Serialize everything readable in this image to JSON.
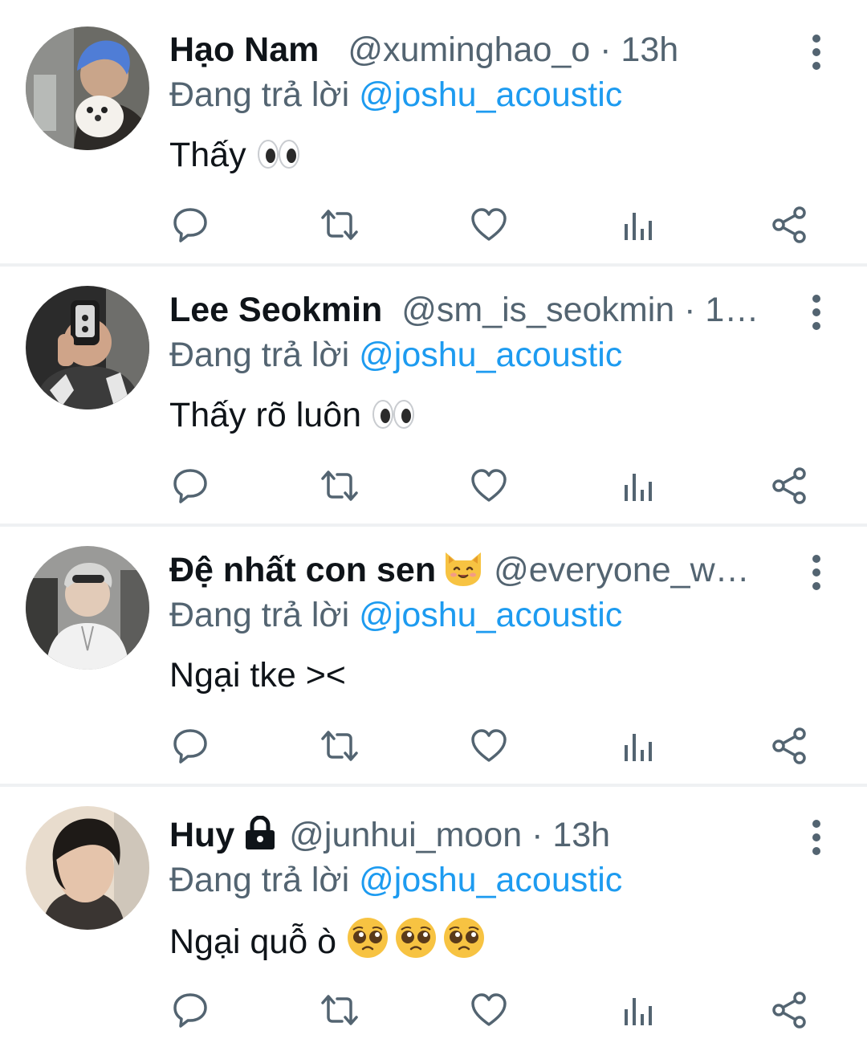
{
  "reply_prefix": "Đang trả lời",
  "tweets": [
    {
      "name": "Hạo Nam",
      "handle": "@xuminghao_o",
      "meta": " · 13h",
      "reply_to": "@joshu_acoustic",
      "text": "Thấy",
      "avatar_colors": {
        "bg": "#6b6b66",
        "hair": "#4f7dd6",
        "skin": "#c9a58a"
      }
    },
    {
      "name": "Lee Seokmin",
      "handle": "@sm_is_seokmin",
      "meta": " · 1…",
      "reply_to": "@joshu_acoustic",
      "text": "Thấy rõ luôn",
      "avatar_colors": {
        "bg": "#2b2b2b",
        "shirt": "#3b3b3b",
        "skin": "#cfa489"
      }
    },
    {
      "name": "Đệ nhất con sen",
      "handle": "@everyone_w…",
      "meta": "",
      "reply_to": "@joshu_acoustic",
      "text": "Ngại tke ><",
      "avatar_colors": {
        "bg": "#9a9a98",
        "shirt": "#f1f1f1",
        "skin": "#e2cbb8"
      }
    },
    {
      "name": "Huy",
      "handle": "@junhui_moon",
      "meta": " · 13h",
      "reply_to": "@joshu_acoustic",
      "text": "Ngại quỗ ò",
      "avatar_colors": {
        "bg": "#e8dccd",
        "hair": "#1e1a17",
        "skin": "#e5c4ab"
      }
    }
  ],
  "action_icons": [
    "reply-icon",
    "retweet-icon",
    "like-icon",
    "views-icon",
    "share-icon"
  ],
  "colors": {
    "text": "#0f1419",
    "secondary": "#536471",
    "link": "#1d9bf0",
    "divider": "#eff1f3"
  }
}
